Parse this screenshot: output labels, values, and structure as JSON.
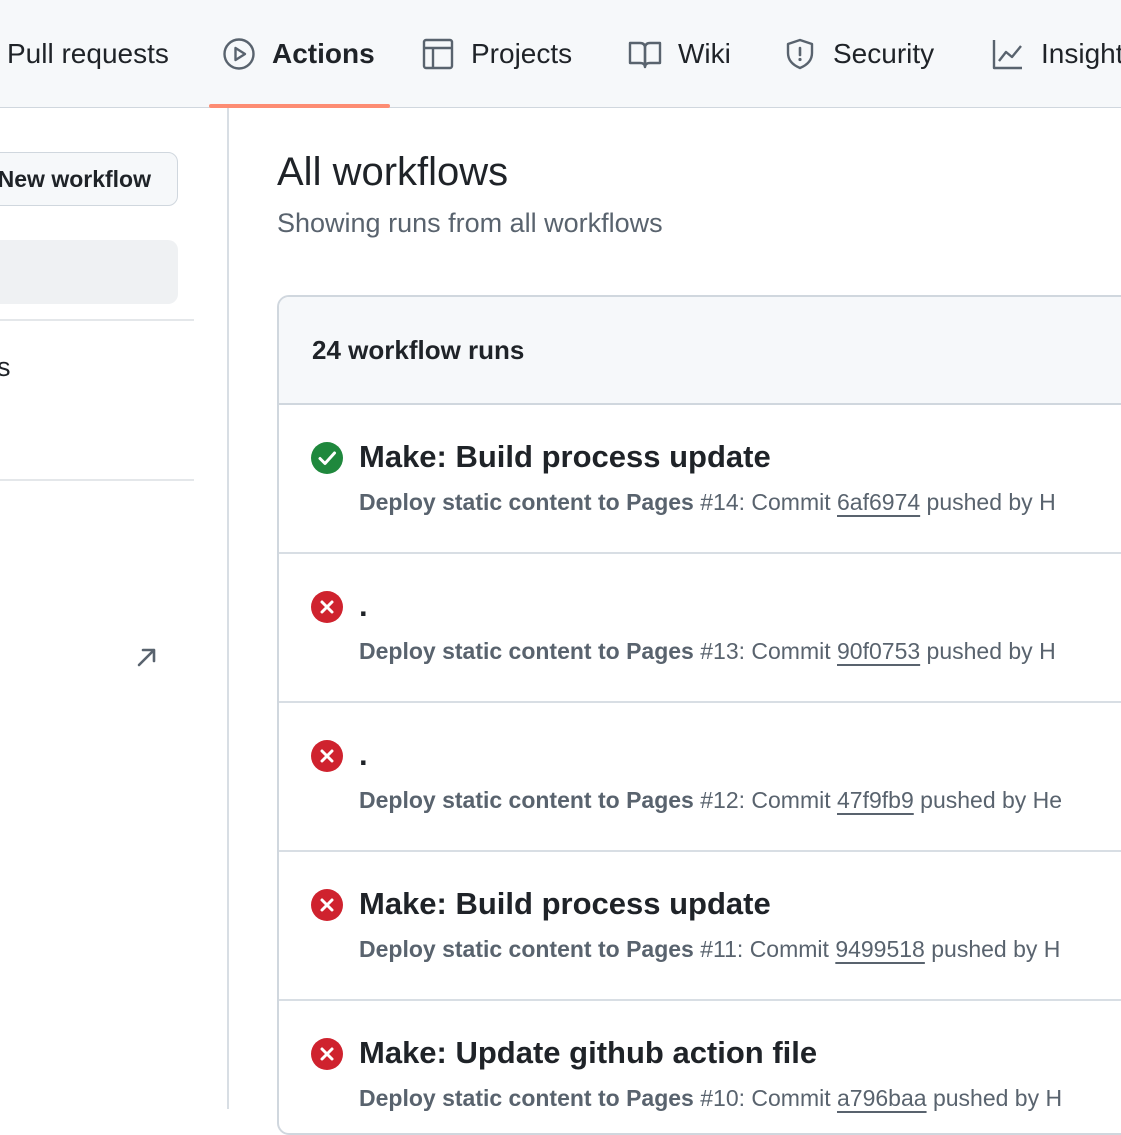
{
  "nav": {
    "tabs": [
      {
        "label": "Pull requests",
        "icon": "pull-request-icon"
      },
      {
        "label": "Actions",
        "icon": "play-icon",
        "active": true
      },
      {
        "label": "Projects",
        "icon": "table-icon"
      },
      {
        "label": "Wiki",
        "icon": "book-icon"
      },
      {
        "label": "Security",
        "icon": "shield-icon"
      },
      {
        "label": "Insights",
        "icon": "graph-icon"
      }
    ],
    "active_underline_color": "#fd8c73"
  },
  "sidebar": {
    "new_workflow_label": "New workflow",
    "item_text": "s",
    "external_link_icon": "arrow-up-right-icon"
  },
  "main": {
    "title": "All workflows",
    "subtitle": "Showing runs from all workflows",
    "runs_count_label": "24 workflow runs",
    "runs": [
      {
        "status": "success",
        "title": "Make: Build process update",
        "workflow": "Deploy static content to Pages",
        "run_number": "#14",
        "commit_prefix": ": Commit ",
        "sha": "6af6974",
        "suffix": " pushed by H"
      },
      {
        "status": "failure",
        "title": ".",
        "workflow": "Deploy static content to Pages",
        "run_number": "#13",
        "commit_prefix": ": Commit ",
        "sha": "90f0753",
        "suffix": " pushed by H"
      },
      {
        "status": "failure",
        "title": ".",
        "workflow": "Deploy static content to Pages",
        "run_number": "#12",
        "commit_prefix": ": Commit ",
        "sha": "47f9fb9",
        "suffix": " pushed by He"
      },
      {
        "status": "failure",
        "title": "Make: Build process update",
        "workflow": "Deploy static content to Pages",
        "run_number": "#11",
        "commit_prefix": ": Commit ",
        "sha": "9499518",
        "suffix": " pushed by H"
      },
      {
        "status": "failure",
        "title": "Make: Update github action file",
        "workflow": "Deploy static content to Pages",
        "run_number": "#10",
        "commit_prefix": ": Commit ",
        "sha": "a796baa",
        "suffix": " pushed by H"
      }
    ]
  },
  "colors": {
    "success": "#1f883d",
    "failure": "#cf222e"
  }
}
